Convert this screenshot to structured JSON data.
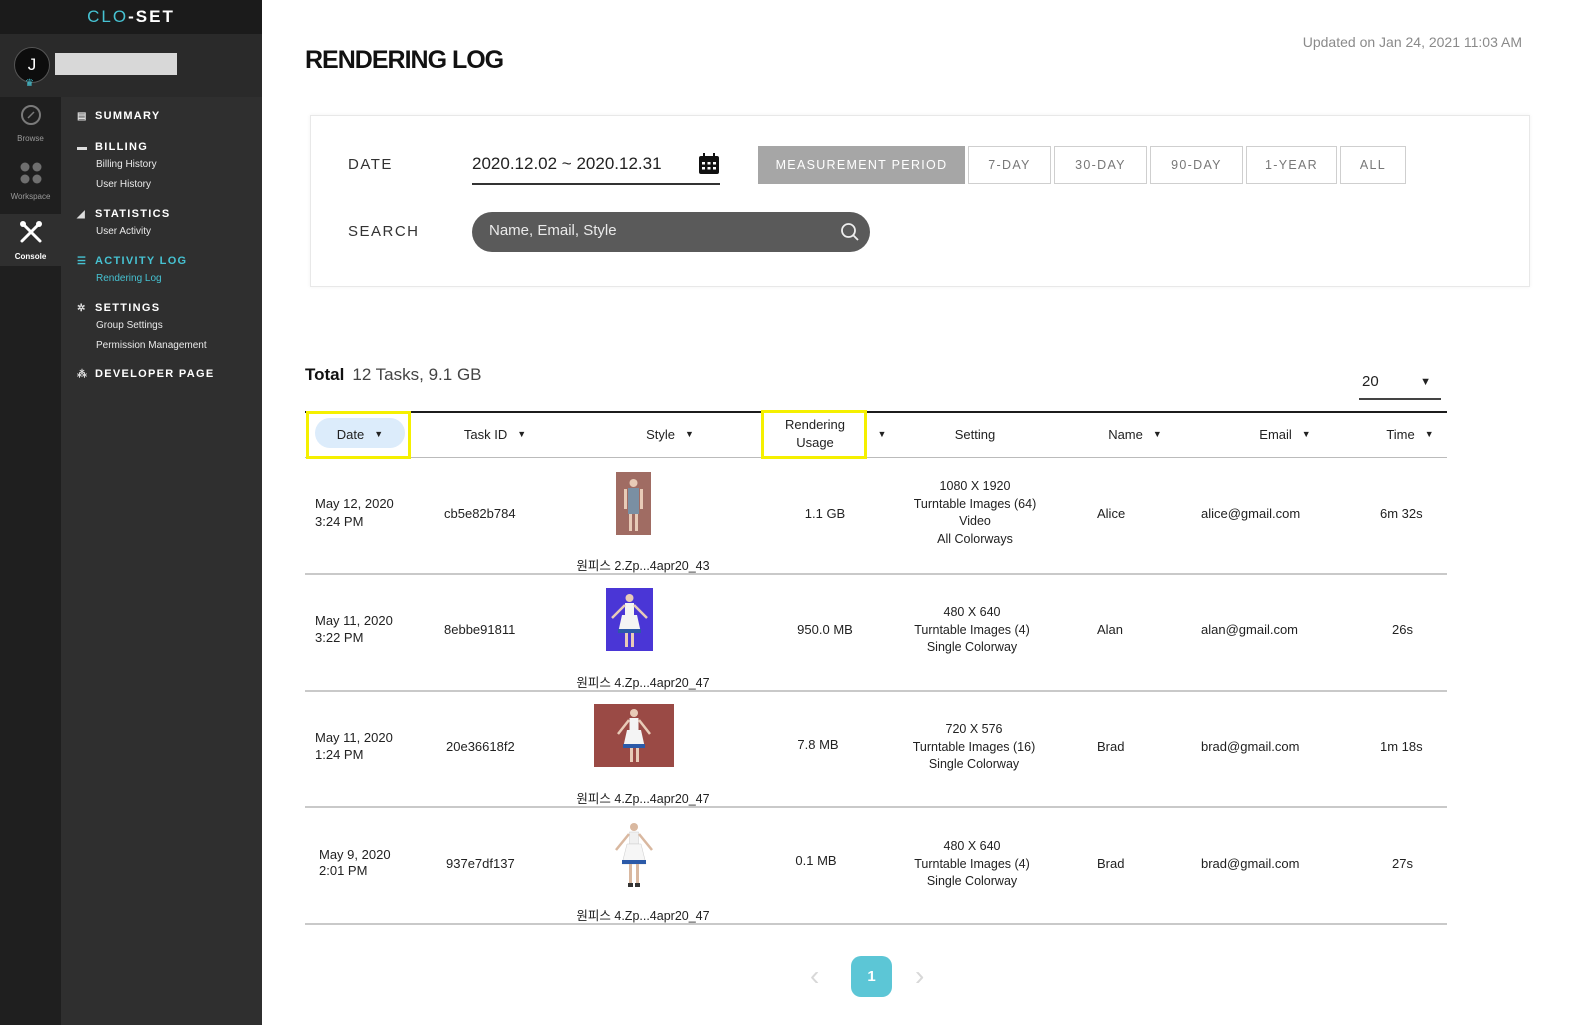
{
  "app": {
    "logo_prefix": "CLO",
    "logo_suffix": "-SET"
  },
  "user": {
    "initial": "J"
  },
  "rail": [
    {
      "label": "Browse",
      "icon": "compass-icon"
    },
    {
      "label": "Workspace",
      "icon": "grid-icon"
    },
    {
      "label": "Console",
      "icon": "tools-icon",
      "active": true
    }
  ],
  "menu": {
    "summary": "SUMMARY",
    "billing": "BILLING",
    "billing_history": "Billing History",
    "user_history": "User History",
    "statistics": "STATISTICS",
    "user_activity": "User Activity",
    "activity_log": "ACTIVITY LOG",
    "rendering_log": "Rendering Log",
    "settings": "SETTINGS",
    "group_settings": "Group Settings",
    "permission_management": "Permission Management",
    "developer_page": "DEVELOPER PAGE"
  },
  "page": {
    "title": "RENDERING LOG",
    "updated": "Updated on Jan 24, 2021 11:03 AM"
  },
  "filters": {
    "date_label": "DATE",
    "date_value": "2020.12.02 ~ 2020.12.31",
    "search_label": "SEARCH",
    "search_placeholder": "Name, Email, Style",
    "periods": [
      "MEASUREMENT PERIOD",
      "7-DAY",
      "30-DAY",
      "90-DAY",
      "1-YEAR",
      "ALL"
    ],
    "active_period": "MEASUREMENT PERIOD"
  },
  "summary": {
    "total_label": "Total",
    "total_value": "12 Tasks, 9.1 GB",
    "per_page": "20"
  },
  "table": {
    "headers": {
      "date": "Date",
      "task_id": "Task ID",
      "style": "Style",
      "usage_line1": "Rendering",
      "usage_line2": "Usage",
      "setting": "Setting",
      "name": "Name",
      "email": "Email",
      "time": "Time"
    },
    "rows": [
      {
        "date": "May 12, 2020",
        "time_of_day": "3:24 PM",
        "task_id": "cb5e82b784",
        "style": "원피스 2.Zp...4apr20_43",
        "usage": "1.1 GB",
        "setting": [
          "1080 X 1920",
          "Turntable Images (64)",
          "Video",
          "All Colorways"
        ],
        "name": "Alice",
        "email": "alice@gmail.com",
        "time": "6m 32s"
      },
      {
        "date": "May 11, 2020",
        "time_of_day": "3:22 PM",
        "task_id": "8ebbe91811",
        "style": "원피스 4.Zp...4apr20_47",
        "usage": "950.0 MB",
        "setting": [
          "480 X 640",
          "Turntable Images (4)",
          "Single Colorway"
        ],
        "name": "Alan",
        "email": "alan@gmail.com",
        "time": "26s"
      },
      {
        "date": "May 11, 2020",
        "time_of_day": "1:24 PM",
        "task_id": "20e36618f2",
        "style": "원피스 4.Zp...4apr20_47",
        "usage": "7.8 MB",
        "setting": [
          "720 X 576",
          "Turntable Images (16)",
          "Single Colorway"
        ],
        "name": "Brad",
        "email": "brad@gmail.com",
        "time": "1m 18s"
      },
      {
        "date": "May 9, 2020",
        "time_of_day": "2:01 PM",
        "task_id": "937e7df137",
        "style": "원피스 4.Zp...4apr20_47",
        "usage": "0.1 MB",
        "setting": [
          "480 X 640",
          "Turntable Images (4)",
          "Single Colorway"
        ],
        "name": "Brad",
        "email": "brad@gmail.com",
        "time": "27s"
      }
    ]
  },
  "pagination": {
    "current": "1",
    "prev_icon": "chevron-left-icon",
    "next_icon": "chevron-right-icon"
  },
  "colors": {
    "accent": "#5cc6d6",
    "highlight": "#f5f000",
    "sidebar": "#2f2f2f"
  }
}
